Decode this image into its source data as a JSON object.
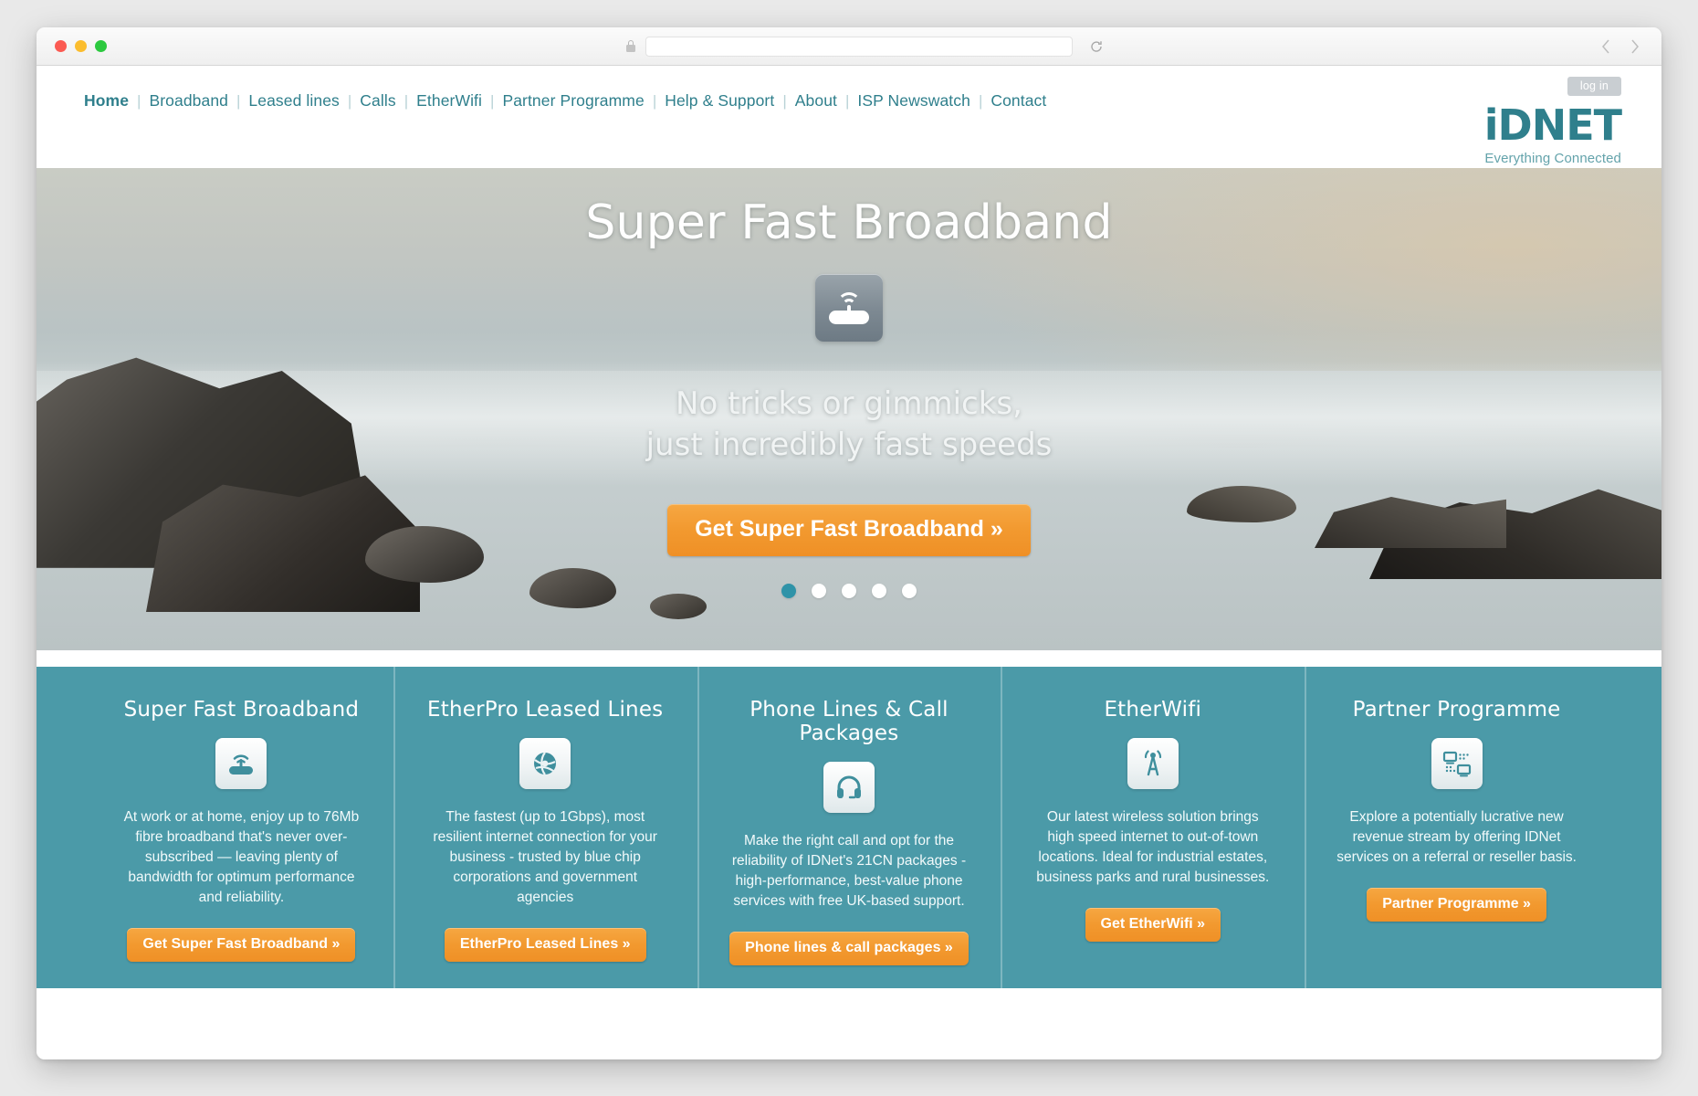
{
  "browser": {
    "url": "",
    "url_placeholder": "",
    "lock_icon": "lock-icon",
    "reload_icon": "reload-icon",
    "back_icon": "chevron-left-icon",
    "forward_icon": "chevron-right-icon"
  },
  "header": {
    "nav": [
      {
        "label": "Home",
        "active": true
      },
      {
        "label": "Broadband",
        "active": false
      },
      {
        "label": "Leased lines",
        "active": false
      },
      {
        "label": "Calls",
        "active": false
      },
      {
        "label": "EtherWifi",
        "active": false
      },
      {
        "label": "Partner Programme",
        "active": false
      },
      {
        "label": "Help & Support",
        "active": false
      },
      {
        "label": "About",
        "active": false
      },
      {
        "label": "ISP Newswatch",
        "active": false
      },
      {
        "label": "Contact",
        "active": false
      }
    ],
    "login_label": "log in",
    "logo_mark": "iDNET",
    "logo_tagline": "Everything Connected"
  },
  "hero": {
    "title": "Super Fast Broadband",
    "icon": "wifi-router-icon",
    "subtitle_line1": "No tricks or gimmicks,",
    "subtitle_line2": "just incredibly fast speeds",
    "cta_label": "Get Super Fast Broadband »",
    "slide_count": 5,
    "active_slide": 1,
    "active_dot_color": "#2f93a8"
  },
  "features": {
    "background_color": "#4b9aa8",
    "accent_color": "#f2992f",
    "items": [
      {
        "title": "Super Fast Broadband",
        "icon": "wifi-router-icon",
        "body": "At work or at home, enjoy up to 76Mb fibre broadband that's never over-subscribed — leaving plenty of bandwidth for optimum performance and reliability.",
        "cta": "Get Super Fast Broadband »"
      },
      {
        "title": "EtherPro Leased Lines",
        "icon": "fibre-globe-icon",
        "body": "The fastest (up to 1Gbps), most resilient internet connection for your business - trusted by blue chip corporations and government agencies",
        "cta": "EtherPro Leased Lines »"
      },
      {
        "title": "Phone Lines & Call Packages",
        "icon": "headset-icon",
        "body": "Make the right call and opt for the reliability of IDNet's 21CN packages - high-performance, best-value phone services with free UK-based support.",
        "cta": "Phone lines & call packages »"
      },
      {
        "title": "EtherWifi",
        "icon": "broadcast-tower-icon",
        "body": "Our latest wireless solution brings high speed internet to out-of-town locations. Ideal for industrial estates, business parks and rural businesses.",
        "cta": "Get EtherWifi »"
      },
      {
        "title": "Partner Programme",
        "icon": "network-computers-icon",
        "body": "Explore a potentially lucrative new revenue stream by offering IDNet services on a referral or reseller basis.",
        "cta": "Partner Programme »"
      }
    ]
  }
}
